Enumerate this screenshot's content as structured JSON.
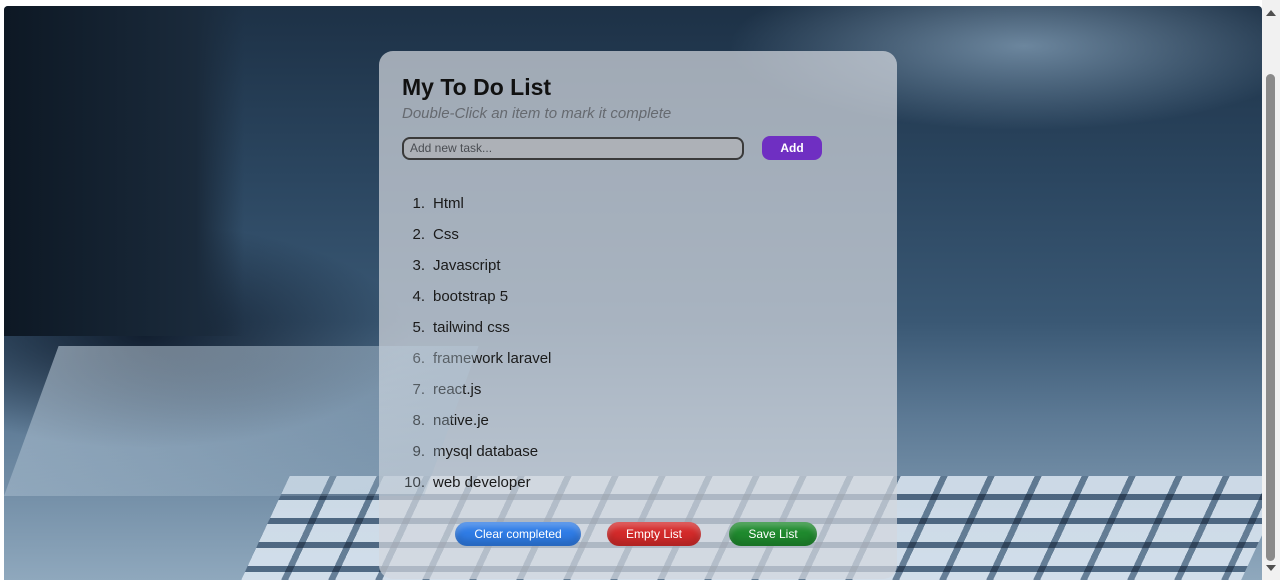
{
  "app": {
    "title": "My To Do List",
    "subtitle": "Double-Click an item to mark it complete"
  },
  "input": {
    "placeholder": "Add new task...",
    "value": "",
    "add_label": "Add"
  },
  "tasks": [
    {
      "number": "1.",
      "text": "Html"
    },
    {
      "number": "2.",
      "text": "Css"
    },
    {
      "number": "3.",
      "text": "Javascript"
    },
    {
      "number": "4.",
      "text": "bootstrap 5"
    },
    {
      "number": "5.",
      "text": "tailwind css"
    },
    {
      "number": "6.",
      "text": "framework laravel"
    },
    {
      "number": "7.",
      "text": "react.js"
    },
    {
      "number": "8.",
      "text": "native.je"
    },
    {
      "number": "9.",
      "text": "mysql database"
    },
    {
      "number": "10.",
      "text": "web developer"
    }
  ],
  "footer": {
    "clear_label": "Clear completed",
    "empty_label": "Empty List",
    "save_label": "Save List"
  },
  "colors": {
    "add_button": "#6f2fc2",
    "clear_button": "#2f7ce6",
    "empty_button": "#d42a2a",
    "save_button": "#1f8a2e"
  }
}
